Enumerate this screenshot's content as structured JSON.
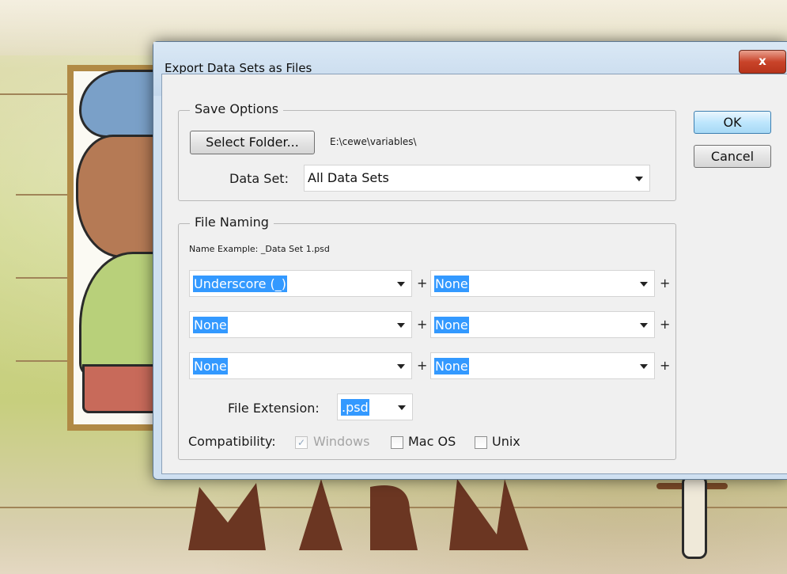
{
  "dialog": {
    "title": "Export Data Sets as Files",
    "close_label": "x",
    "ok_label": "OK",
    "cancel_label": "Cancel"
  },
  "save_options": {
    "legend": "Save Options",
    "select_folder_label": "Select Folder...",
    "folder_path": "E:\\cewe\\variables\\",
    "data_set_label": "Data Set:",
    "data_set_value": "All Data Sets"
  },
  "file_naming": {
    "legend": "File Naming",
    "name_example": "Name Example: _Data Set 1.psd",
    "rows": [
      {
        "left": "Underscore (_)",
        "right": "None"
      },
      {
        "left": "None",
        "right": "None"
      },
      {
        "left": "None",
        "right": "None"
      }
    ],
    "plus": "+",
    "file_extension_label": "File Extension:",
    "file_extension_value": ".psd",
    "compatibility_label": "Compatibility:",
    "compatibility": [
      {
        "label": "Windows",
        "checked": true,
        "disabled": true
      },
      {
        "label": "Mac OS",
        "checked": false,
        "disabled": false
      },
      {
        "label": "Unix",
        "checked": false,
        "disabled": false
      }
    ]
  },
  "icons": {
    "dropdown": "chevron-down-icon",
    "check": "checkmark-icon"
  },
  "colors": {
    "selection_highlight": "#3399ff",
    "close_button": "#c9442a",
    "titlebar": "#c4d8ec"
  }
}
